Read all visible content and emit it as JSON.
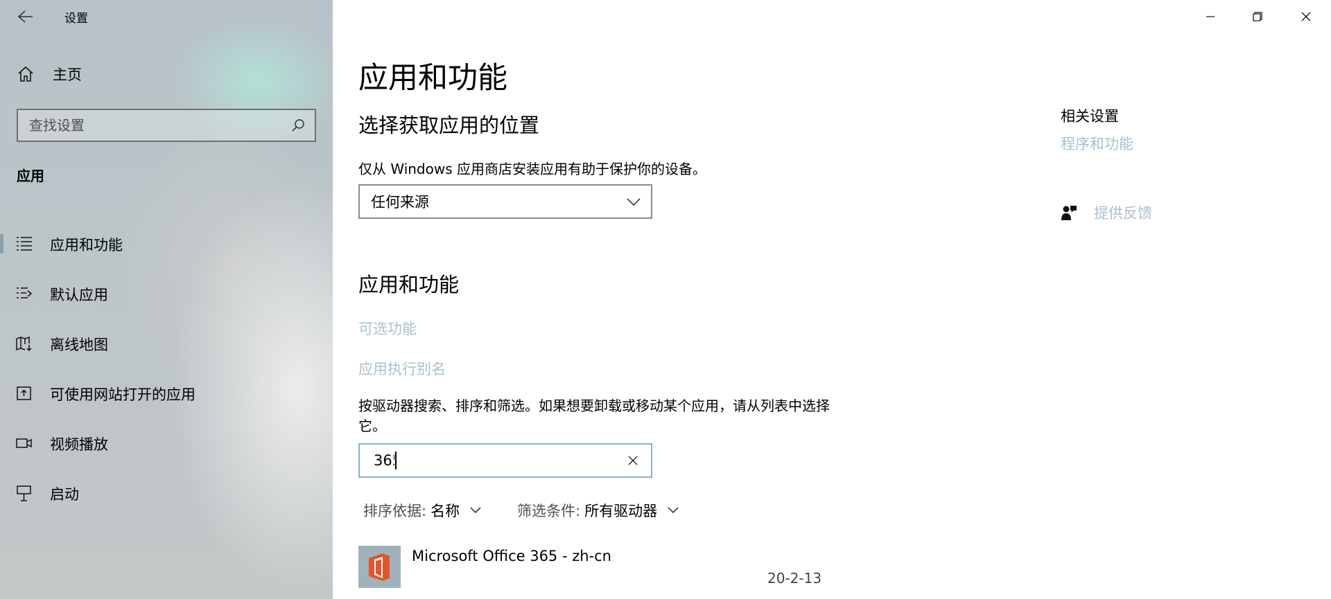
{
  "window": {
    "title": "设置",
    "controls": [
      "minimize",
      "restore",
      "close"
    ]
  },
  "sidebar": {
    "home_label": "主页",
    "search_placeholder": "查找设置",
    "section": "应用",
    "items": [
      {
        "label": "应用和功能",
        "icon": "apps-list-icon",
        "selected": true
      },
      {
        "label": "默认应用",
        "icon": "default-apps-icon",
        "selected": false
      },
      {
        "label": "离线地图",
        "icon": "offline-maps-icon",
        "selected": false
      },
      {
        "label": "可使用网站打开的应用",
        "icon": "apps-for-websites-icon",
        "selected": false
      },
      {
        "label": "视频播放",
        "icon": "video-playback-icon",
        "selected": false
      },
      {
        "label": "启动",
        "icon": "startup-icon",
        "selected": false
      }
    ]
  },
  "main": {
    "title": "应用和功能",
    "install_source": {
      "heading": "选择获取应用的位置",
      "description": "仅从 Windows 应用商店安装应用有助于保护你的设备。",
      "selected": "任何来源"
    },
    "apps_section": {
      "heading": "应用和功能",
      "links": [
        "可选功能",
        "应用执行别名"
      ],
      "help_text": "按驱动器搜索、排序和筛选。如果想要卸载或移动某个应用，请从列表中选择它。",
      "search_value": "365",
      "sort": {
        "key": "排序依据:",
        "value": "名称"
      },
      "filter": {
        "key": "筛选条件:",
        "value": "所有驱动器"
      },
      "apps": [
        {
          "name": "Microsoft Office 365 - zh-cn",
          "date": "20-2-13",
          "icon": "office-icon"
        }
      ]
    }
  },
  "related": {
    "title": "相关设置",
    "link": "程序和功能",
    "feedback": "提供反馈"
  },
  "colors": {
    "link": "#a9c0cc",
    "office_orange": "#e8542a",
    "accent_border": "#8fb0c0"
  }
}
